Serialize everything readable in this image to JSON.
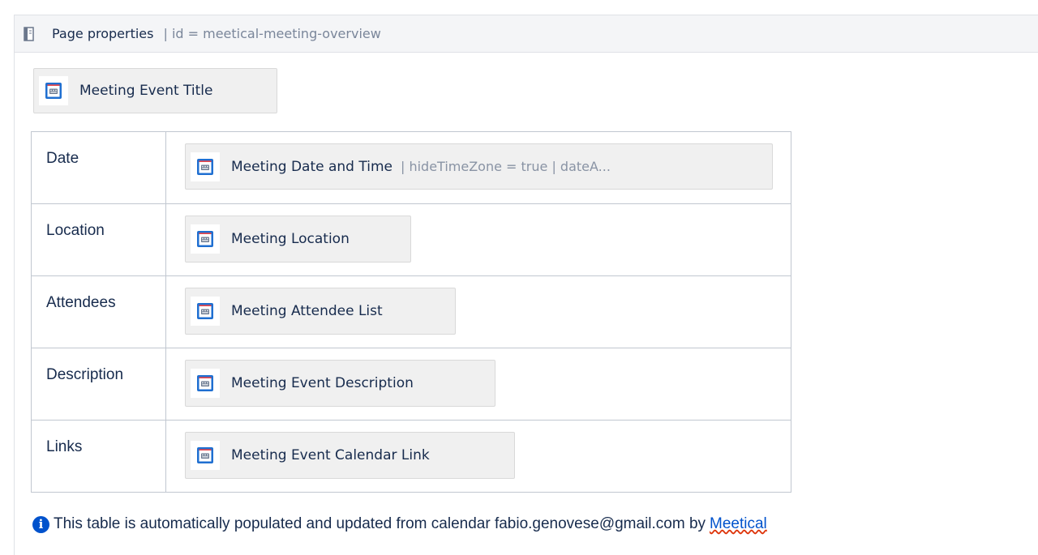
{
  "macro": {
    "name": "Page properties",
    "params": "| id = meetical-meeting-overview",
    "icon": "book-icon"
  },
  "title_placeholder": {
    "label": "Meeting Event Title",
    "icon": "meetical-placeholder-icon"
  },
  "rows": [
    {
      "key": "Date",
      "placeholder": "Meeting Date and Time",
      "params": "| hideTimeZone = true | dateA..."
    },
    {
      "key": "Location",
      "placeholder": "Meeting Location",
      "params": ""
    },
    {
      "key": "Attendees",
      "placeholder": "Meeting Attendee List",
      "params": ""
    },
    {
      "key": "Description",
      "placeholder": "Meeting Event Description",
      "params": ""
    },
    {
      "key": "Links",
      "placeholder": "Meeting Event Calendar Link",
      "params": ""
    }
  ],
  "info": {
    "text": "This table is automatically populated and updated from calendar fabio.genovese@gmail.com by",
    "link": "Meetical",
    "icon": "info-icon"
  },
  "colors": {
    "accent_blue": "#0052cc",
    "icon_red": "#e5484d",
    "header_bg": "#f4f5f7",
    "placeholder_bg": "#f0f0f0"
  }
}
